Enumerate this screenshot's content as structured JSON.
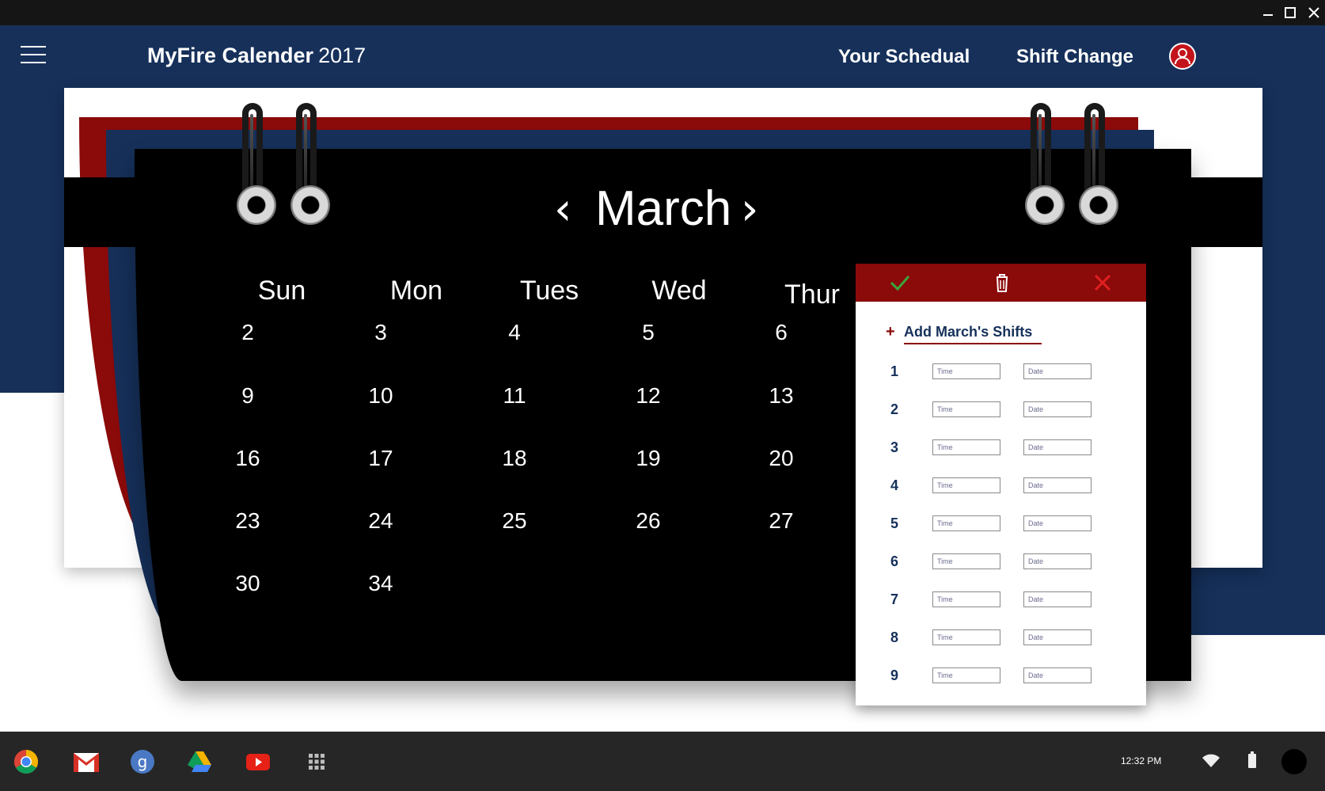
{
  "app": {
    "title_bold": "MyFire Calender",
    "title_year": "2017"
  },
  "nav": {
    "schedule": "Your Schedual",
    "shift_change": "Shift Change"
  },
  "calendar": {
    "month": "March",
    "prev_symbol": "‹",
    "next_symbol": "›",
    "weekdays": [
      "Sun",
      "Mon",
      "Tues",
      "Wed",
      "Thur"
    ],
    "weeks": [
      [
        "2",
        "3",
        "4",
        "5",
        "6"
      ],
      [
        "9",
        "10",
        "11",
        "12",
        "13"
      ],
      [
        "16",
        "17",
        "18",
        "19",
        "20"
      ],
      [
        "23",
        "24",
        "25",
        "26",
        "27"
      ],
      [
        "30",
        "34"
      ]
    ]
  },
  "shift_panel": {
    "add_plus": "+",
    "add_label": "Add March's Shifts",
    "rows": [
      {
        "num": "1",
        "time_placeholder": "Time",
        "date_placeholder": "Date"
      },
      {
        "num": "2",
        "time_placeholder": "Time",
        "date_placeholder": "Date"
      },
      {
        "num": "3",
        "time_placeholder": "Time",
        "date_placeholder": "Date"
      },
      {
        "num": "4",
        "time_placeholder": "Time",
        "date_placeholder": "Date"
      },
      {
        "num": "5",
        "time_placeholder": "Time",
        "date_placeholder": "Date"
      },
      {
        "num": "6",
        "time_placeholder": "Time",
        "date_placeholder": "Date"
      },
      {
        "num": "7",
        "time_placeholder": "Time",
        "date_placeholder": "Date"
      },
      {
        "num": "8",
        "time_placeholder": "Time",
        "date_placeholder": "Date"
      },
      {
        "num": "9",
        "time_placeholder": "Time",
        "date_placeholder": "Date"
      }
    ],
    "actions": [
      "check-icon",
      "trash-icon",
      "close-icon"
    ]
  },
  "taskbar": {
    "time": "12:32 PM",
    "apps": [
      "chrome-icon",
      "gmail-icon",
      "google-plus-icon",
      "drive-icon",
      "youtube-icon",
      "app-launcher-icon"
    ]
  },
  "colors": {
    "navy": "#16305a",
    "red": "#8b0a0a",
    "black": "#000000",
    "confirm_green": "#3aa63a",
    "close_red": "#e02020"
  }
}
